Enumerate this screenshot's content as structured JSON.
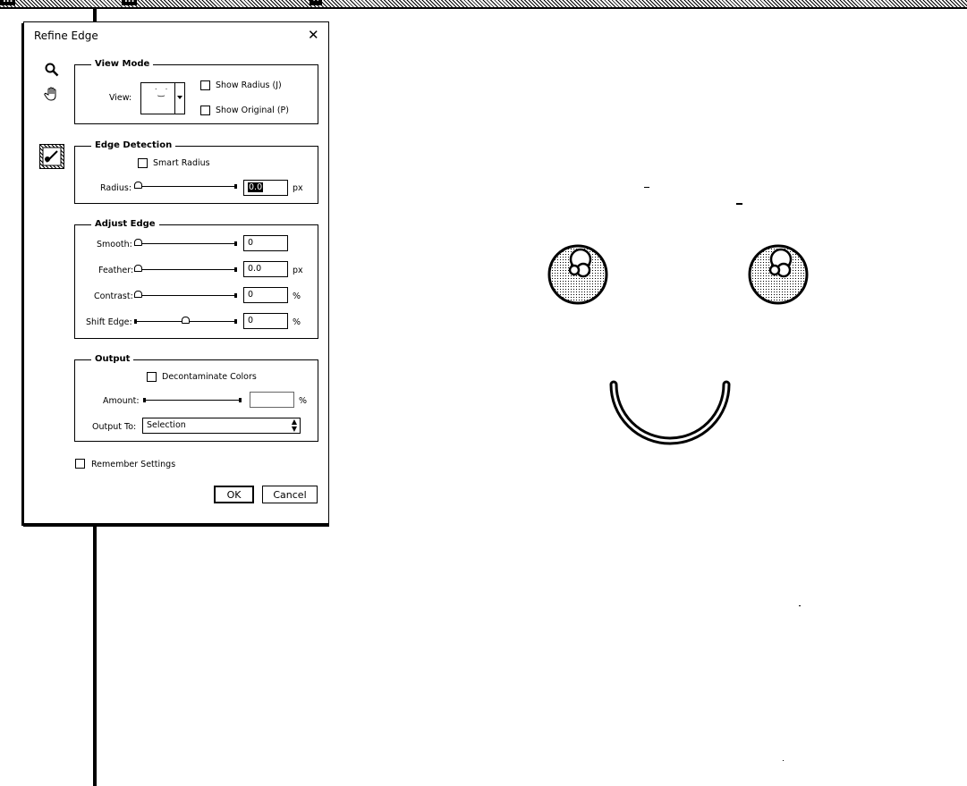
{
  "document": {
    "left_tab": "...",
    "tab_title": "...",
    "tab_close": "✕"
  },
  "dialog": {
    "title": "Refine Edge",
    "close_icon": "✕",
    "tools": [
      "zoom-tool",
      "hand-tool",
      "refine-radius-tool"
    ],
    "view_mode": {
      "legend": "View Mode",
      "view_label": "View:",
      "show_radius": {
        "label": "Show Radius (J)",
        "checked": false
      },
      "show_original": {
        "label": "Show Original (P)",
        "checked": false
      }
    },
    "edge_detection": {
      "legend": "Edge Detection",
      "smart_radius": {
        "label": "Smart Radius",
        "checked": false
      },
      "radius_label": "Radius:",
      "radius_value": "0.0",
      "radius_unit": "px",
      "radius_level": 0
    },
    "adjust_edge": {
      "legend": "Adjust Edge",
      "smooth_label": "Smooth:",
      "smooth_value": "0",
      "smooth_level": 0,
      "feather_label": "Feather:",
      "feather_value": "0.0",
      "feather_unit": "px",
      "feather_level": 0,
      "contrast_label": "Contrast:",
      "contrast_value": "0",
      "contrast_unit": "%",
      "contrast_level": 0,
      "shift_label": "Shift Edge:",
      "shift_value": "0",
      "shift_unit": "%",
      "shift_level": 0.5
    },
    "output": {
      "legend": "Output",
      "decontaminate": {
        "label": "Decontaminate Colors",
        "checked": false
      },
      "amount_label": "Amount:",
      "amount_value": "",
      "amount_unit": "%",
      "output_to_label": "Output To:",
      "output_to_value": "Selection"
    },
    "remember": {
      "label": "Remember Settings",
      "checked": false
    },
    "ok_label": "OK",
    "cancel_label": "Cancel"
  }
}
